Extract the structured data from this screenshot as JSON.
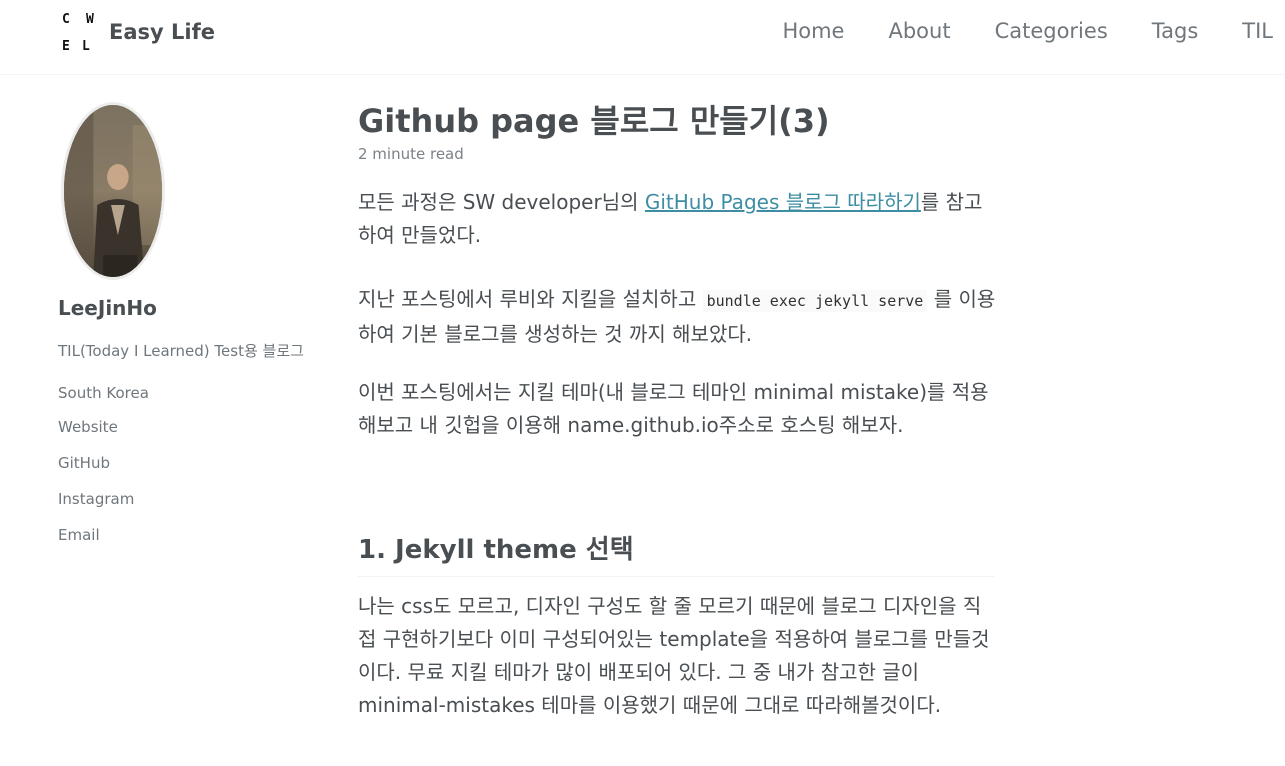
{
  "masthead": {
    "logo": {
      "c": "C",
      "w": "W",
      "e": "E",
      "l": "L"
    },
    "site_title": "Easy Life",
    "nav": [
      "Home",
      "About",
      "Categories",
      "Tags",
      "TIL"
    ]
  },
  "sidebar": {
    "author_name": "LeeJinHo",
    "bio": "TIL(Today I Learned) Test용 블로그",
    "links": [
      "South Korea",
      "Website",
      "GitHub",
      "Instagram",
      "Email"
    ]
  },
  "post": {
    "title": "Github page 블로그 만들기(3)",
    "read_time": "2 minute read",
    "p1_before": "모든 과정은 SW developer님의 ",
    "p1_link": "GitHub Pages 블로그 따라하기",
    "p1_after": "를 참고하여 만들었다.",
    "p2_before": "지난 포스팅에서 루비와 지킬을 설치하고 ",
    "p2_code": "bundle exec jekyll serve",
    "p2_after": " 를 이용하여 기본 블로그를 생성하는 것 까지 해보았다.",
    "p3": "이번 포스팅에서는 지킬 테마(내 블로그 테마인 minimal mistake)를 적용해보고 내 깃헙을 이용해 name.github.io주소로 호스팅 해보자.",
    "section1_heading": "1. Jekyll theme 선택",
    "p4": "나는 css도 모르고, 디자인 구성도 할 줄 모르기 때문에 블로그 디자인을 직접 구현하기보다 이미 구성되어있는 template을 적용하여 블로그를 만들것이다. 무료 지킬 테마가 많이 배포되어 있다. 그 중 내가 참고한 글이 minimal-mistakes 테마를 이용했기 때문에 그대로 따라해볼것이다."
  },
  "colors": {
    "text": "#494e52",
    "muted": "#6f777d",
    "link": "#3d8ea3"
  }
}
